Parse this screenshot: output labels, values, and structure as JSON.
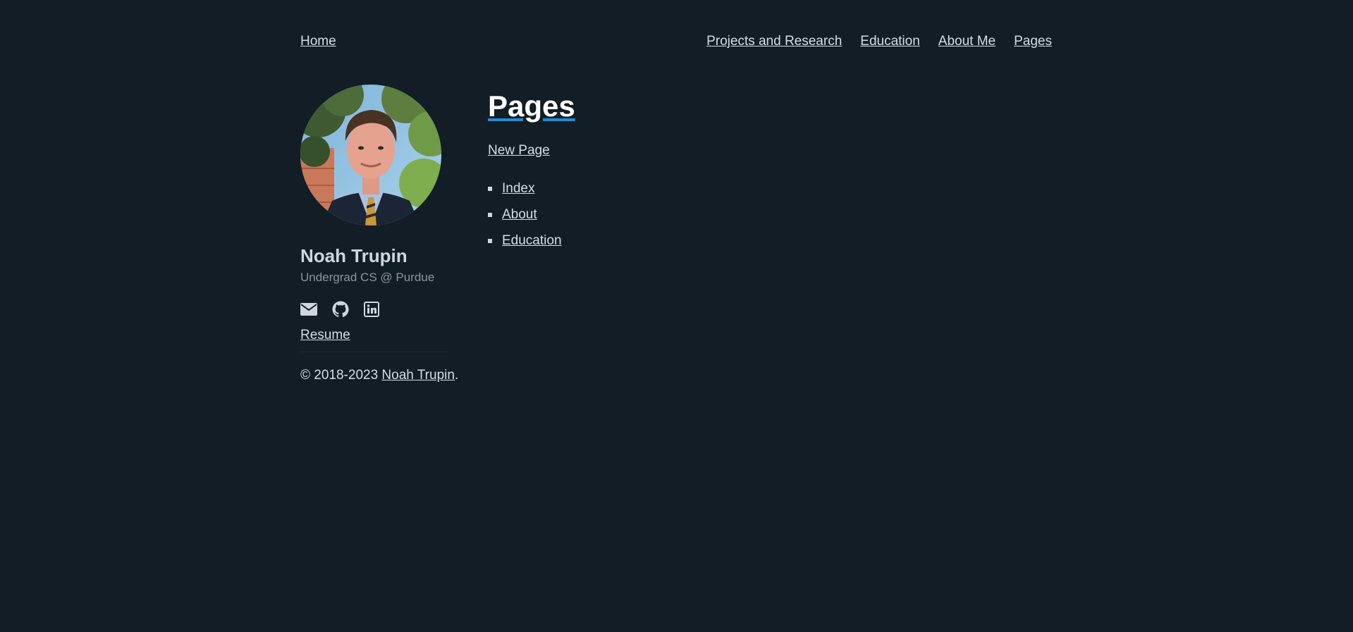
{
  "nav": {
    "home": "Home",
    "links": [
      "Projects and Research",
      "Education",
      "About Me",
      "Pages"
    ]
  },
  "author": {
    "name": "Noah Trupin",
    "tagline": "Undergrad CS @ Purdue",
    "resume": "Resume",
    "socials": [
      "envelope-icon",
      "github-icon",
      "linkedin-icon"
    ]
  },
  "footer": {
    "copyright_prefix": "© 2018-2023 ",
    "copyright_name": "Noah Trupin",
    "copyright_suffix": "."
  },
  "page": {
    "title": "Pages",
    "new_page": "New Page",
    "items": [
      "Index",
      "About",
      "Education"
    ]
  },
  "colors": {
    "background": "#121d25",
    "link": "#d6dde4",
    "title_underline": "#1a8fe0"
  }
}
